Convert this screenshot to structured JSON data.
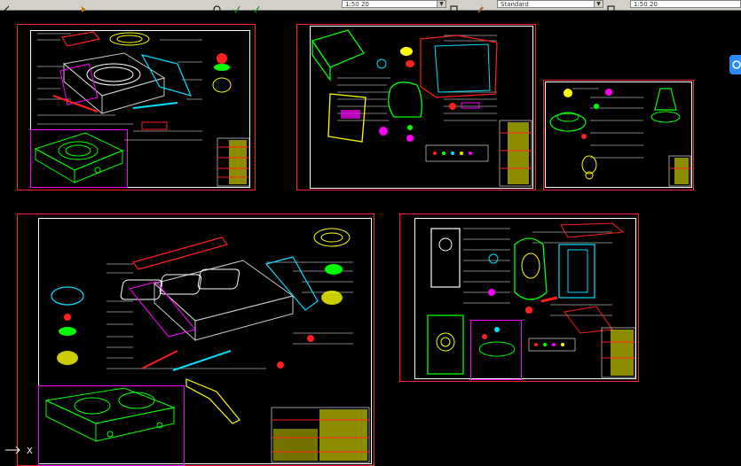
{
  "toolbar": {
    "scale_left": "1:50   20",
    "scale_right": "1:50   20",
    "layer_style": "Standard",
    "icons": [
      "arrow-icon",
      "pointer-icon",
      "circle-icon",
      "check-icon",
      "check-icon",
      "text-style-icon",
      "brush-icon",
      "dim-style-icon"
    ]
  },
  "colors": {
    "sheet_border": "#ff2020",
    "frame": "#ffffff",
    "accent": "#ff00ff",
    "background": "#000000"
  }
}
